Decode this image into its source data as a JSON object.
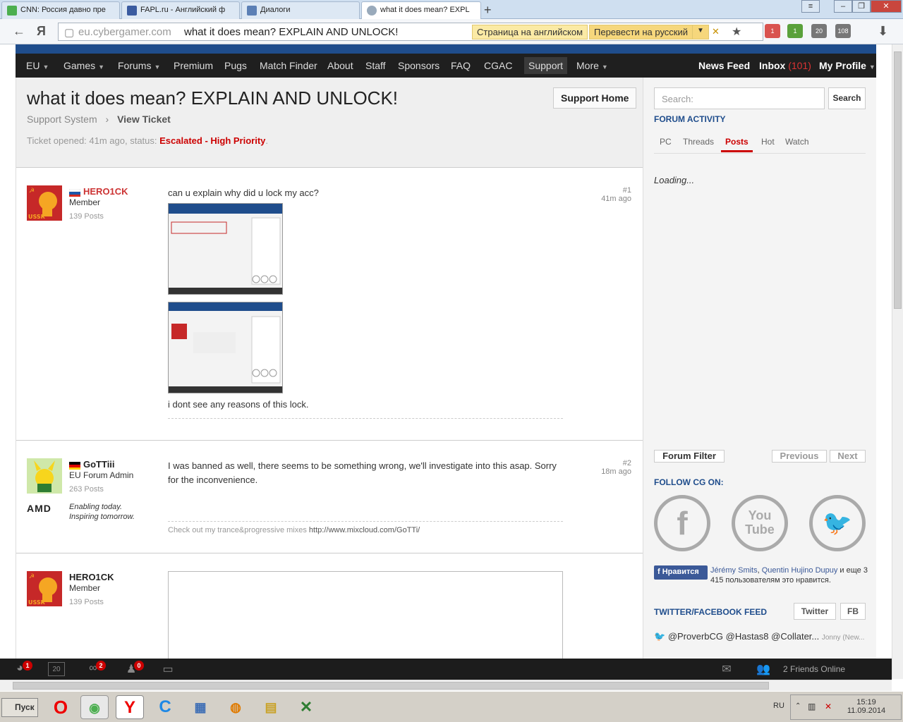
{
  "browser": {
    "tabs": [
      {
        "title": "CNN: Россия давно пре"
      },
      {
        "title": "FAPL.ru - Английский ф"
      },
      {
        "title": "Диалоги"
      },
      {
        "title": "what it does mean? EXPL"
      }
    ],
    "url_domain": "eu.cybergamer.com",
    "url_title": "what it does mean? EXPLAIN AND UNLOCK!",
    "translate_page_lang": "Страница на английском",
    "translate_button": "Перевести на русский",
    "extension_badges": [
      "1",
      "1",
      "20",
      "108"
    ]
  },
  "site": {
    "nav": [
      "EU",
      "Games",
      "Forums",
      "Premium",
      "Pugs",
      "Match Finder",
      "About",
      "Staff",
      "Sponsors",
      "FAQ",
      "CGAC",
      "Support",
      "More"
    ],
    "nav_right": {
      "news": "News Feed",
      "inbox": "Inbox",
      "inbox_count": "(101)",
      "profile": "My Profile"
    }
  },
  "ticket": {
    "title": "what it does mean? EXPLAIN AND UNLOCK!",
    "support_home": "Support Home",
    "breadcrumb_root": "Support System",
    "breadcrumb_current": "View Ticket",
    "status_prefix": "Ticket opened: 41m ago, status: ",
    "status_value": "Escalated - High Priority",
    "status_suffix": "."
  },
  "posts": [
    {
      "user": "HERO1CK",
      "role": "Member",
      "posts": "139 Posts",
      "num": "#1",
      "ago": "41m ago",
      "text1": "can u explain why did u lock my acc?",
      "text2": "i dont see any reasons of this lock."
    },
    {
      "user": "GoTTiii",
      "role": "EU Forum Admin",
      "posts": "263 Posts",
      "num": "#2",
      "ago": "18m ago",
      "text1": "I was banned as well, there seems to be something wrong, we'll investigate into this asap. Sorry for the inconvenience.",
      "signature_prefix": "Check out my trance&progressive mixes ",
      "signature_link": "http://www.mixcloud.com/GoTTi/",
      "sponsor_logo": "AMD",
      "sponsor_tagline1": "Enabling today.",
      "sponsor_tagline2": "Inspiring tomorrow."
    },
    {
      "user": "HERO1CK",
      "role": "Member",
      "posts": "139 Posts"
    }
  ],
  "sidebar": {
    "search_placeholder": "Search:",
    "search_button": "Search",
    "forum_activity": "FORUM ACTIVITY",
    "tabs": [
      "PC",
      "Threads",
      "Posts",
      "Hot",
      "Watch"
    ],
    "loading": "Loading...",
    "forum_filter": "Forum Filter",
    "previous": "Previous",
    "next": "Next",
    "follow": "FOLLOW CG ON:",
    "like_button": "Нравится",
    "like_name1": "Jérémy Smits",
    "like_sep": ", ",
    "like_name2": "Quentin Hujino Dupuy",
    "like_rest": " и еще 3 415 пользователям это нравится.",
    "feed_title": "TWITTER/FACEBOOK FEED",
    "twitter": "Twitter",
    "fb": "FB",
    "tweet": "@ProverbCG @Hastas8 @Collater...",
    "tweet_author": "Jonny (New..."
  },
  "bottombar": {
    "badges": [
      "1",
      "2",
      "0"
    ],
    "calendar_day": "20",
    "friends_online": "2 Friends Online"
  },
  "taskbar": {
    "start": "Пуск",
    "lang": "RU",
    "time": "15:19",
    "date": "11.09.2014"
  }
}
